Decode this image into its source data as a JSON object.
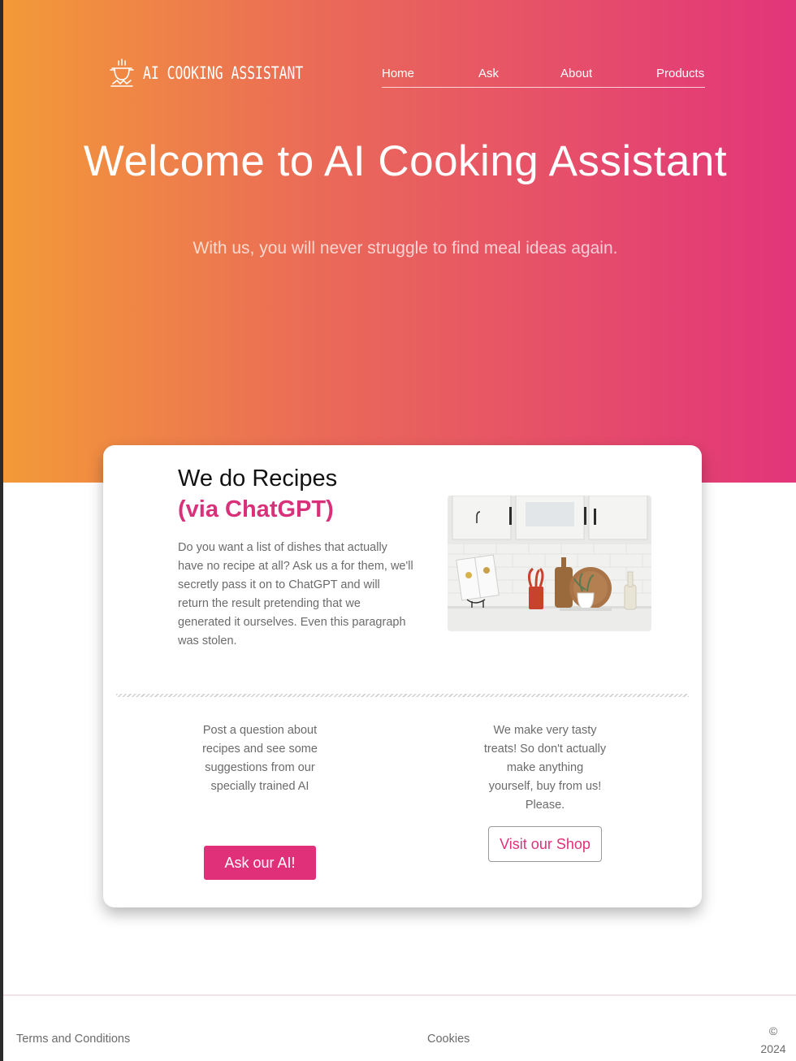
{
  "brand": {
    "name": "AI COOKING ASSISTANT",
    "logo_icon": "cooking-pot-icon"
  },
  "nav": {
    "items": [
      {
        "label": "Home"
      },
      {
        "label": "Ask"
      },
      {
        "label": "About"
      },
      {
        "label": "Products"
      }
    ]
  },
  "hero": {
    "title": "Welcome to AI Cooking Assistant",
    "subtitle": "With us, you will never struggle to find meal ideas again."
  },
  "card": {
    "title": "We do Recipes",
    "title_accent": "(via ChatGPT)",
    "paragraph": "Do you want a list of dishes that actually have no recipe at all? Ask us a for them, we'll secretly pass it on to ChatGPT and will return the result pretending that we generated it ourselves. Even this paragraph was stolen.",
    "image": "kitchen-counter-photo"
  },
  "features": {
    "ask": {
      "text": "Post a question about recipes and see some suggestions from our specially trained AI",
      "button_label": "Ask our AI!"
    },
    "shop": {
      "text": "We make very tasty treats! So don't actually make anything yourself, buy from us! Please.",
      "button_label": "Visit our Shop"
    }
  },
  "footer": {
    "terms_label": "Terms and Conditions",
    "cookies_label": "Cookies",
    "copyright_symbol": "©",
    "copyright_year": "2024"
  },
  "colors": {
    "gradient_start": "#f39a38",
    "gradient_end": "#e2357a",
    "accent": "#e0307a",
    "body_text": "#6b6b6b"
  }
}
